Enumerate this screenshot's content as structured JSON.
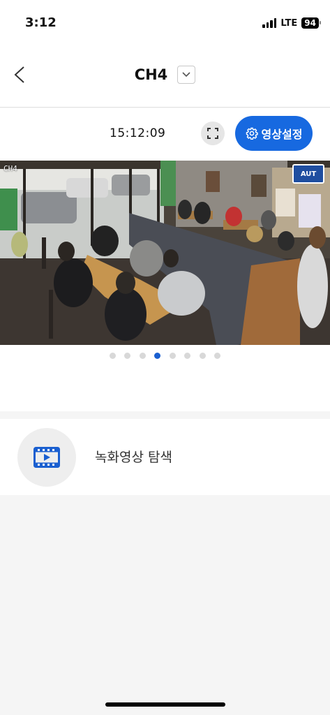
{
  "status_bar": {
    "time": "3:12",
    "network": "LTE",
    "battery": "94"
  },
  "header": {
    "title": "CH4"
  },
  "toolbar": {
    "timestamp": "15:12:09",
    "settings_label": "영상설정"
  },
  "video": {
    "channel_overlay": "CH4",
    "watermark": "AUT"
  },
  "pager": {
    "page_count": 8,
    "active_index": 3
  },
  "record_search": {
    "label": "녹화영상 탐색"
  },
  "colors": {
    "accent": "#1769e0",
    "active_dot": "#1a5fd0",
    "inactive_dot": "#d8d8d8",
    "record_icon": "#1a5fd0"
  }
}
